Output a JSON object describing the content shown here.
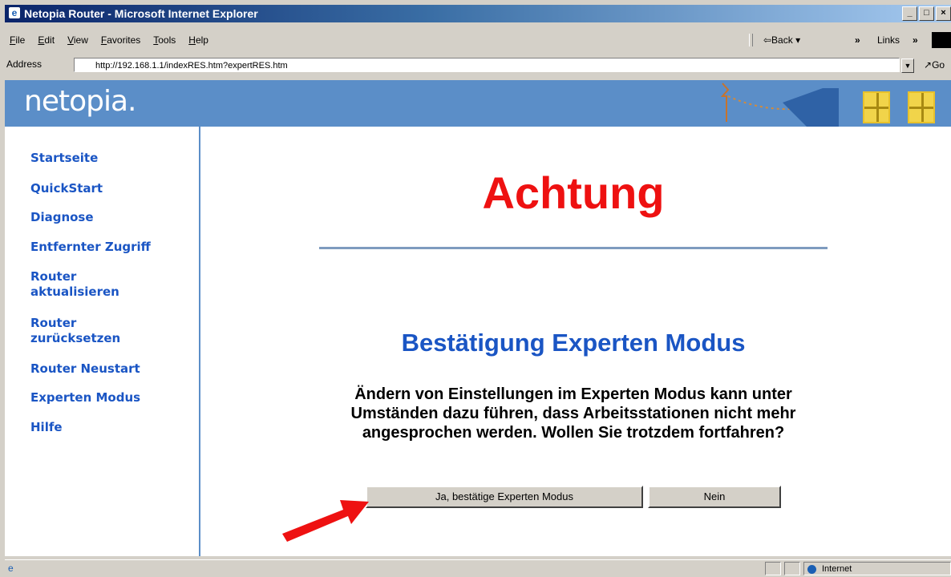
{
  "window": {
    "title": "Netopia Router - Microsoft Internet Explorer",
    "controls": {
      "minimize": "_",
      "maximize": "□",
      "close": "×"
    }
  },
  "menubar": {
    "items": [
      "File",
      "Edit",
      "View",
      "Favorites",
      "Tools",
      "Help"
    ],
    "back_label": "⇦Back ▾",
    "chevron": "»",
    "links_label": "Links"
  },
  "addressbar": {
    "label": "Address",
    "url": "http://192.168.1.1/indexRES.htm?expertRES.htm",
    "go_label": "Go"
  },
  "banner": {
    "logo_text": "netopia."
  },
  "sidebar": {
    "items": [
      "Startseite",
      "QuickStart",
      "Diagnose",
      "Entfernter Zugriff",
      "Router aktualisieren",
      "Router zurücksetzen",
      "Router Neustart",
      "Experten Modus",
      "Hilfe"
    ]
  },
  "main": {
    "heading": "Achtung",
    "subheading": "Bestätigung Experten Modus",
    "message": "Ändern von Einstellungen im Experten Modus kann unter Umständen dazu führen, dass Arbeitsstationen nicht mehr angesprochen werden. Wollen Sie trotzdem fortfahren?",
    "confirm_button": "Ja, bestätige Experten Modus",
    "cancel_button": "Nein"
  },
  "statusbar": {
    "zone": "Internet"
  },
  "colors": {
    "banner": "#5b8ec8",
    "nav_link": "#1a55c4",
    "heading": "#ee1111",
    "arrow": "#ee1111"
  }
}
